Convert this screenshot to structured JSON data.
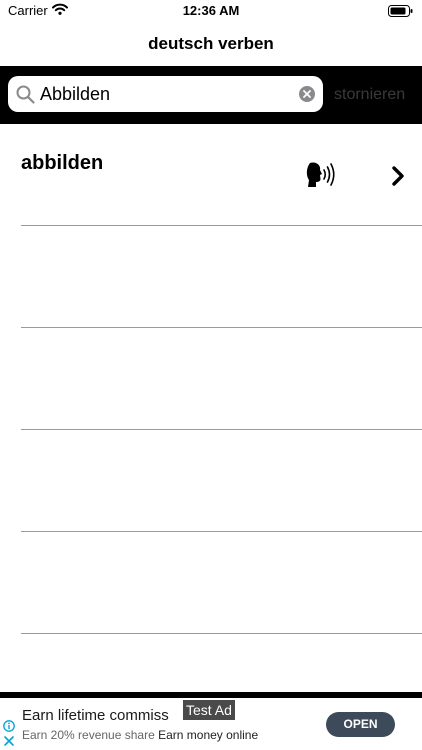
{
  "status_bar": {
    "carrier": "Carrier",
    "time": "12:36 AM"
  },
  "nav": {
    "title": "deutsch verben"
  },
  "search": {
    "value": "Abbilden",
    "cancel_label": "stornieren"
  },
  "results": [
    {
      "word": "abbilden"
    }
  ],
  "ad": {
    "badge": "Test Ad",
    "headline": "Earn lifetime commiss",
    "body_prefix": "Earn 20% revenue share",
    "body_suffix": "Earn money online",
    "cta": "OPEN"
  }
}
